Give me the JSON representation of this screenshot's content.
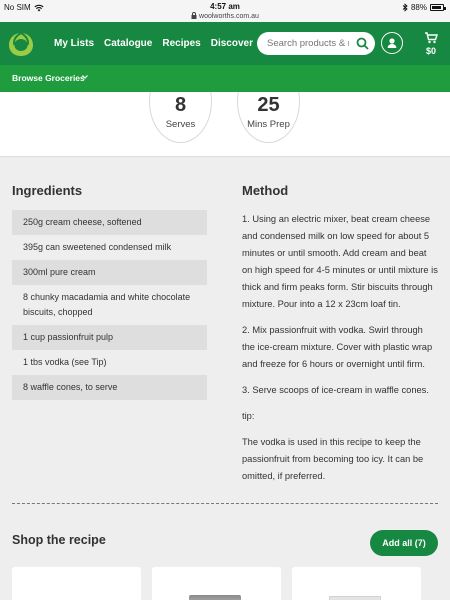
{
  "status_bar": {
    "carrier": "No SIM",
    "time": "4:57 am",
    "url": "woolworths.com.au",
    "battery": "88%"
  },
  "nav": {
    "links": [
      "My Lists",
      "Catalogue",
      "Recipes",
      "Discover"
    ],
    "search_placeholder": "Search products & recipes",
    "cart_total": "$0"
  },
  "browse": {
    "label": "Browse Groceries"
  },
  "stats": [
    {
      "value": "8",
      "label": "Serves"
    },
    {
      "value": "25",
      "label": "Mins Prep"
    }
  ],
  "ingredients": {
    "heading": "Ingredients",
    "items": [
      "250g cream cheese, softened",
      "395g can sweetened condensed milk",
      "300ml pure cream",
      "8 chunky macadamia and white chocolate biscuits, chopped",
      "1 cup passionfruit pulp",
      "1 tbs vodka (see Tip)",
      "8 waffle cones, to serve"
    ]
  },
  "method": {
    "heading": "Method",
    "steps": [
      "1. Using an electric mixer, beat cream cheese and condensed milk on low speed for about 5 minutes or until smooth. Add cream and beat on high speed for 4-5 minutes or until mixture is thick and firm peaks form. Stir biscuits through mixture. Pour into a 12 x 23cm loaf tin.",
      "2. Mix passionfruit with vodka. Swirl through the ice-cream mixture. Cover with plastic wrap and freeze for 6 hours or overnight until firm.",
      "3. Serve scoops of ice-cream in waffle cones."
    ],
    "tip_label": "tip:",
    "tip_text": "The vodka is used in this recipe to keep the passionfruit from becoming too icy. It can be omitted, if preferred."
  },
  "shop": {
    "title": "Shop the recipe",
    "add_all_label": "Add all (7)"
  },
  "colors": {
    "brand_green": "#178841",
    "browse_green": "#1f9d3e",
    "logo_lime": "#9acc46"
  },
  "icons": [
    "wifi-icon",
    "lock-icon",
    "bluetooth-icon",
    "battery-icon",
    "woolworths-logo-icon",
    "search-icon",
    "account-icon",
    "cart-icon",
    "chevron-down-icon"
  ]
}
